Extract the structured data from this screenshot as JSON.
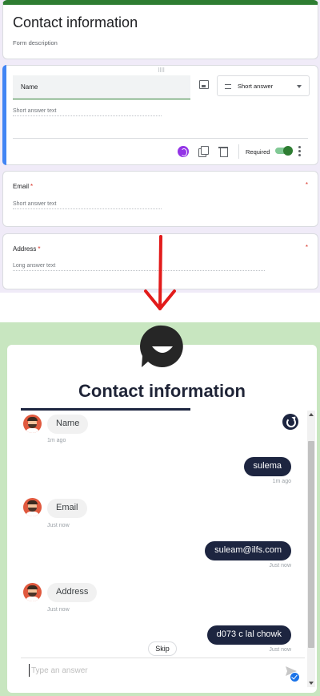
{
  "form": {
    "title": "Contact information",
    "description": "Form description",
    "questions": [
      {
        "title": "Name",
        "answer_hint": "Short answer text",
        "type_label": "Short answer",
        "required_label": "Required",
        "required": true
      },
      {
        "title": "Email",
        "answer_hint": "Short answer text",
        "required_star": "*"
      },
      {
        "title": "Address",
        "answer_hint": "Long answer text",
        "required_star": "*"
      }
    ],
    "colors": {
      "theme": "#2e7d32",
      "active_accent": "#4285f4",
      "required": "#d93025",
      "arrow": "#e21b1b"
    }
  },
  "chat": {
    "title": "Contact information",
    "messages": [
      {
        "from": "bot",
        "text": "Name",
        "time": "1m ago"
      },
      {
        "from": "user",
        "text": "sulema",
        "time": "1m ago"
      },
      {
        "from": "bot",
        "text": "Email",
        "time": "Just now"
      },
      {
        "from": "user",
        "text": "suleam@ilfs.com",
        "time": "Just now"
      },
      {
        "from": "bot",
        "text": "Address",
        "time": "Just now"
      },
      {
        "from": "user",
        "text": "d073 c lal chowk",
        "time": "Just now"
      }
    ],
    "skip_label": "Skip",
    "input_placeholder": "Type an answer",
    "colors": {
      "background": "#c8e6c0",
      "user_bubble": "#1d2540",
      "bot_bubble": "#f1f1f1"
    }
  }
}
